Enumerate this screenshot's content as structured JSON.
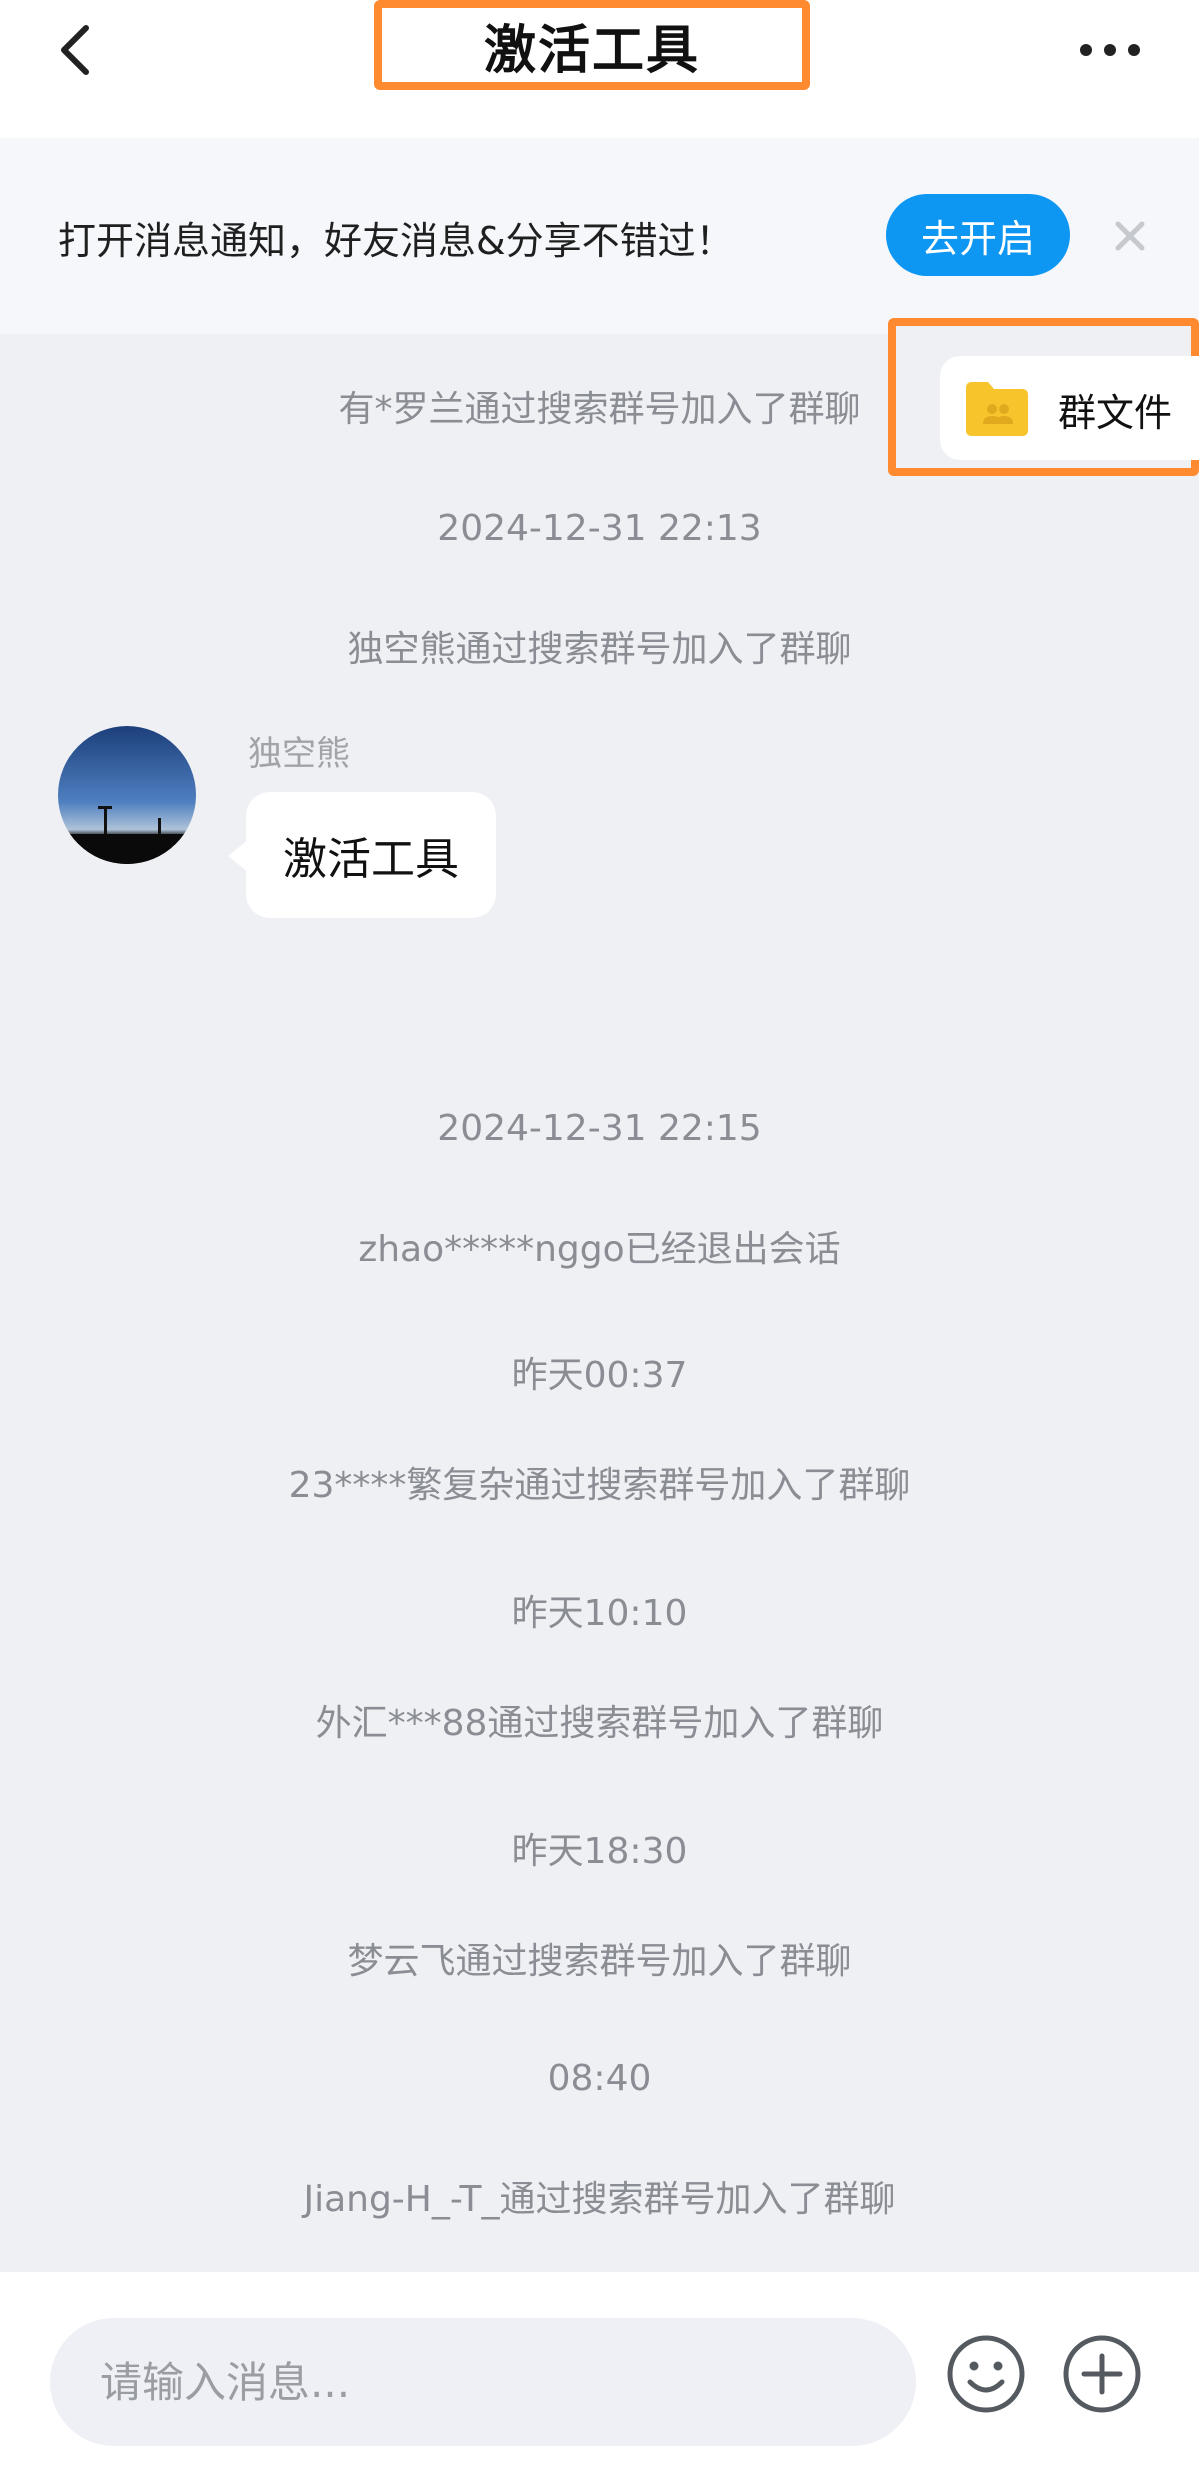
{
  "header": {
    "title": "激活工具",
    "back_icon": "chevron-left-icon",
    "more_icon": "more-dots-icon"
  },
  "notification": {
    "text": "打开消息通知，好友消息&分享不错过！",
    "button_label": "去开启",
    "close_icon": "close-icon"
  },
  "group_files": {
    "label": "群文件",
    "icon": "folder-group-icon",
    "folder_color": "#f7c52b"
  },
  "chat": {
    "events": [
      {
        "type": "system",
        "text": "有*罗兰通过搜索群号加入了群聊"
      },
      {
        "type": "time",
        "text": "2024-12-31 22:13"
      },
      {
        "type": "system",
        "text": "独空熊通过搜索群号加入了群聊"
      }
    ],
    "message": {
      "sender": "独空熊",
      "text": "激活工具"
    },
    "events_after": [
      {
        "type": "time",
        "text": "2024-12-31 22:15"
      },
      {
        "type": "system",
        "text": "zhao*****nggo已经退出会话"
      },
      {
        "type": "time",
        "text": "昨天00:37"
      },
      {
        "type": "system",
        "text": "23****繁复杂通过搜索群号加入了群聊"
      },
      {
        "type": "time",
        "text": "昨天10:10"
      },
      {
        "type": "system",
        "text": "外汇***88通过搜索群号加入了群聊"
      },
      {
        "type": "time",
        "text": "昨天18:30"
      },
      {
        "type": "system",
        "text": "梦云飞通过搜索群号加入了群聊"
      },
      {
        "type": "time",
        "text": "08:40"
      },
      {
        "type": "system",
        "text": "Jiang-H_-T_通过搜索群号加入了群聊"
      }
    ]
  },
  "input_bar": {
    "placeholder": "请输入消息...",
    "emoji_icon": "emoji-smile-icon",
    "plus_icon": "plus-circle-icon"
  },
  "colors": {
    "accent": "#0d96f2",
    "highlight_border": "#ff8a2f",
    "background": "#eef0f4"
  }
}
